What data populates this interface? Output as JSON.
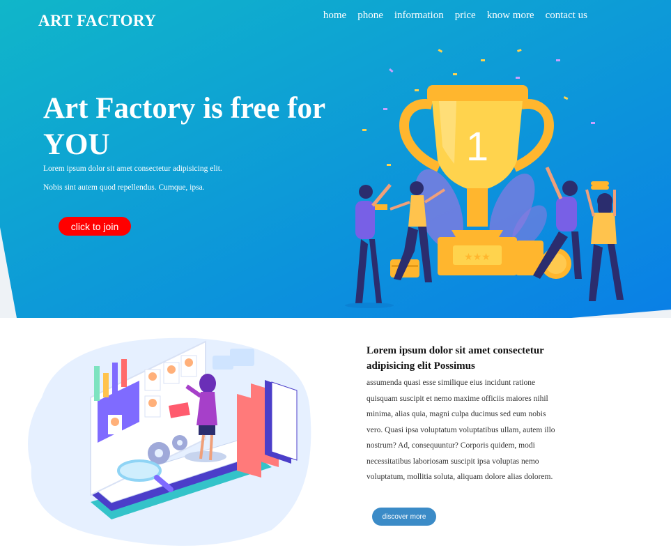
{
  "header": {
    "logo": "ART FACTORY",
    "nav": [
      "home",
      "phone",
      "information",
      "price",
      "know more",
      "contact us"
    ]
  },
  "hero": {
    "headline": "Art Factory is free for YOU",
    "sub1": "Lorem ipsum dolor sit amet consectetur adipisicing elit.",
    "sub2": "Nobis sint autem quod repellendus. Cumque, ipsa.",
    "cta": "click to join",
    "trophy_number": "1"
  },
  "about": {
    "title": "Lorem ipsum dolor sit amet consectetur adipisicing elit Possimus",
    "body": "assumenda quasi esse similique eius incidunt ratione quisquam suscipit et nemo maxime officiis maiores nihil minima, alias quia, magni culpa ducimus sed eum nobis vero. Quasi ipsa voluptatum voluptatibus ullam, autem illo nostrum? Ad, consequuntur? Corporis quidem, modi necessitatibus laboriosam suscipit ipsa voluptas nemo voluptatum, mollitia soluta, aliquam dolore alias dolorem.",
    "cta": "discover more"
  },
  "colors": {
    "hero_gradient_start": "#0fb2c8",
    "hero_gradient_end": "#0a84e4",
    "join_button": "#ff0000",
    "discover_button": "#3b8bc7",
    "trophy": "#ffc53a"
  }
}
